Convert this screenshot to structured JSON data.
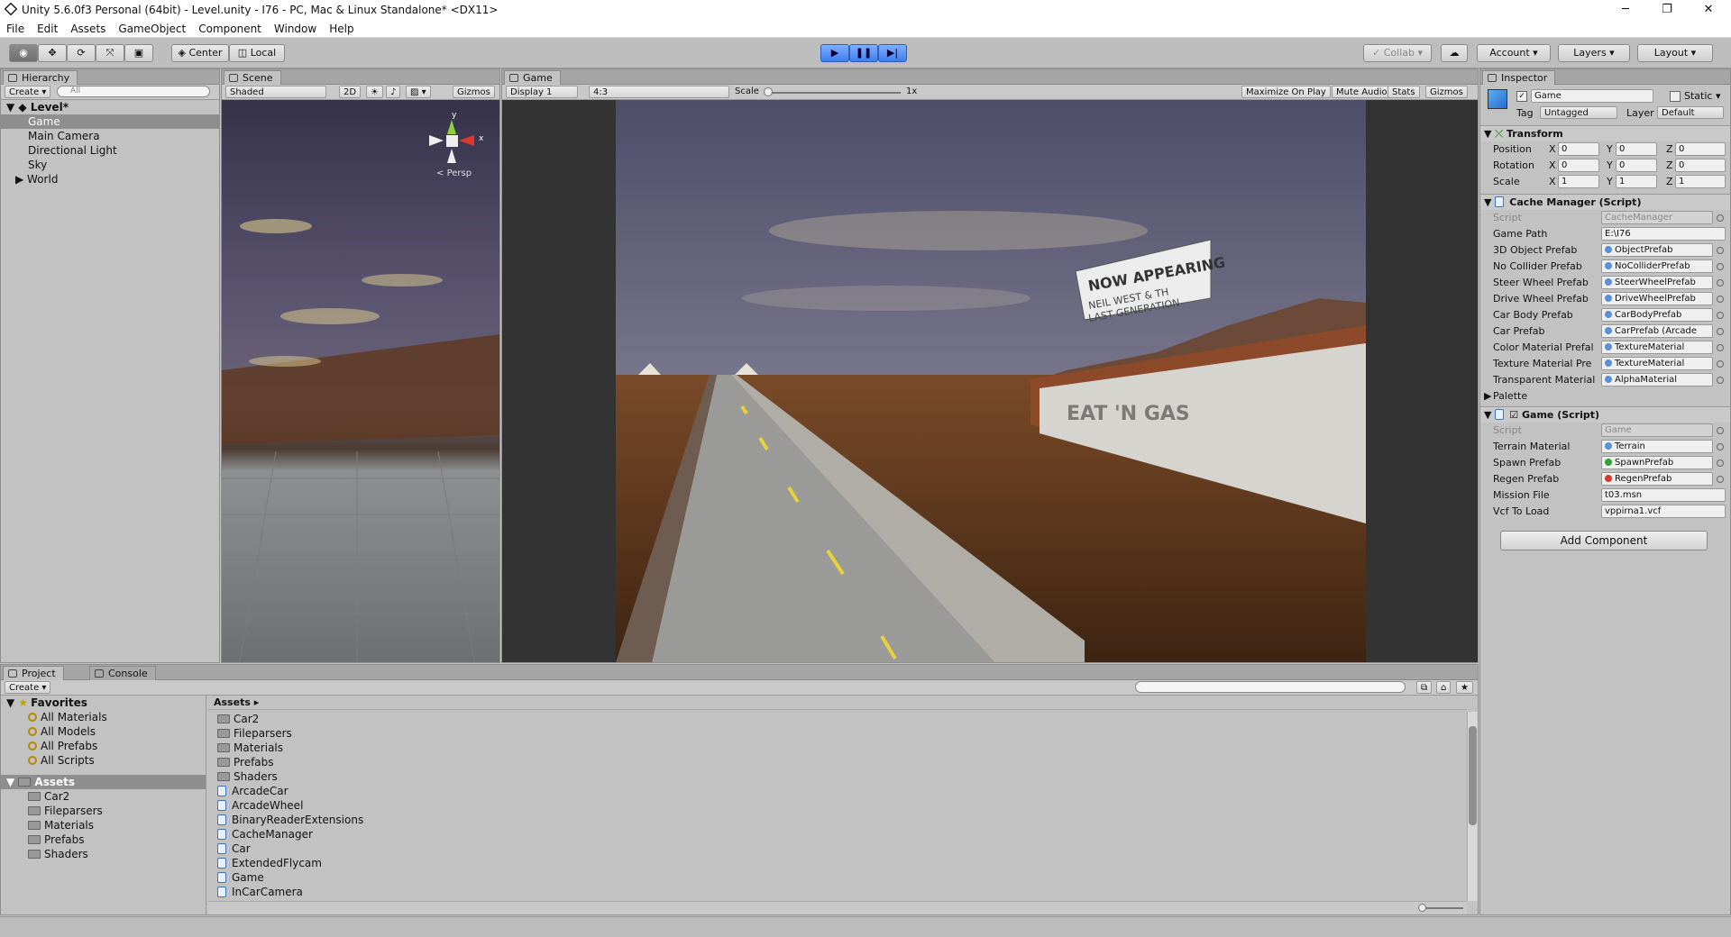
{
  "window": {
    "title": "Unity 5.6.0f3 Personal (64bit) - Level.unity - I76 - PC, Mac & Linux Standalone* <DX11>",
    "min": "─",
    "max": "❐",
    "close": "✕"
  },
  "menu": [
    "File",
    "Edit",
    "Assets",
    "GameObject",
    "Component",
    "Window",
    "Help"
  ],
  "toolbar": {
    "center": "Center",
    "local": "Local",
    "collab": "Collab",
    "account": "Account",
    "layers": "Layers",
    "layout": "Layout"
  },
  "hierarchy": {
    "tab": "Hierarchy",
    "create": "Create",
    "search_placeholder": "All",
    "scene": "Level*",
    "items": [
      "Game",
      "Main Camera",
      "Directional Light",
      "Sky",
      "World"
    ]
  },
  "scene_view": {
    "tab": "Scene",
    "shading": "Shaded",
    "mode_2d": "2D",
    "gizmos": "Gizmos",
    "persp": "Persp",
    "axis_y": "y",
    "axis_x": "x"
  },
  "game_view": {
    "tab": "Game",
    "display": "Display 1",
    "aspect": "4:3",
    "scale_label": "Scale",
    "scale_value": "1x",
    "maximize": "Maximize On Play",
    "mute": "Mute Audio",
    "stats": "Stats",
    "gizmos": "Gizmos",
    "billboard_title": "NOW APPEARING",
    "billboard_line1": "NEIL WEST & TH",
    "billboard_line2": "LAST GENERATION",
    "building_sign": "EAT 'N GAS"
  },
  "inspector": {
    "tab": "Inspector",
    "object_name": "Game",
    "static": "Static",
    "tag_label": "Tag",
    "tag_value": "Untagged",
    "layer_label": "Layer",
    "layer_value": "Default",
    "transform": {
      "title": "Transform",
      "position": {
        "label": "Position",
        "x": "0",
        "y": "0",
        "z": "0"
      },
      "rotation": {
        "label": "Rotation",
        "x": "0",
        "y": "0",
        "z": "0"
      },
      "scale": {
        "label": "Scale",
        "x": "1",
        "y": "1",
        "z": "1"
      }
    },
    "cache_manager": {
      "title": "Cache Manager (Script)",
      "fields": [
        {
          "label": "Script",
          "value": "CacheManager"
        },
        {
          "label": "Game Path",
          "value": "E:\\I76"
        },
        {
          "label": "3D Object Prefab",
          "value": "ObjectPrefab"
        },
        {
          "label": "No Collider Prefab",
          "value": "NoColliderPrefab"
        },
        {
          "label": "Steer Wheel Prefab",
          "value": "SteerWheelPrefab"
        },
        {
          "label": "Drive Wheel Prefab",
          "value": "DriveWheelPrefab"
        },
        {
          "label": "Car Body Prefab",
          "value": "CarBodyPrefab"
        },
        {
          "label": "Car Prefab",
          "value": "CarPrefab (Arcade"
        },
        {
          "label": "Color Material Prefal",
          "value": "TextureMaterial"
        },
        {
          "label": "Texture Material Pre",
          "value": "TextureMaterial"
        },
        {
          "label": "Transparent Material",
          "value": "AlphaMaterial"
        }
      ],
      "palette": "Palette"
    },
    "game_script": {
      "title": "Game (Script)",
      "fields": [
        {
          "label": "Script",
          "value": "Game"
        },
        {
          "label": "Terrain Material",
          "value": "Terrain"
        },
        {
          "label": "Spawn Prefab",
          "value": "SpawnPrefab"
        },
        {
          "label": "Regen Prefab",
          "value": "RegenPrefab"
        },
        {
          "label": "Mission File",
          "value": "t03.msn"
        },
        {
          "label": "Vcf To Load",
          "value": "vppirna1.vcf"
        }
      ]
    },
    "add_component": "Add Component"
  },
  "project": {
    "tab_project": "Project",
    "tab_console": "Console",
    "create": "Create",
    "favorites_label": "Favorites",
    "favorites": [
      "All Materials",
      "All Models",
      "All Prefabs",
      "All Scripts"
    ],
    "assets_label": "Assets",
    "asset_folders": [
      "Car2",
      "Fileparsers",
      "Materials",
      "Prefabs",
      "Shaders"
    ],
    "breadcrumb": "Assets",
    "files": [
      {
        "name": "Car2",
        "type": "folder"
      },
      {
        "name": "Fileparsers",
        "type": "folder"
      },
      {
        "name": "Materials",
        "type": "folder"
      },
      {
        "name": "Prefabs",
        "type": "folder"
      },
      {
        "name": "Shaders",
        "type": "folder"
      },
      {
        "name": "ArcadeCar",
        "type": "script"
      },
      {
        "name": "ArcadeWheel",
        "type": "script"
      },
      {
        "name": "BinaryReaderExtensions",
        "type": "script"
      },
      {
        "name": "CacheManager",
        "type": "script"
      },
      {
        "name": "Car",
        "type": "script"
      },
      {
        "name": "ExtendedFlycam",
        "type": "script"
      },
      {
        "name": "Game",
        "type": "script"
      },
      {
        "name": "InCarCamera",
        "type": "script"
      }
    ]
  }
}
